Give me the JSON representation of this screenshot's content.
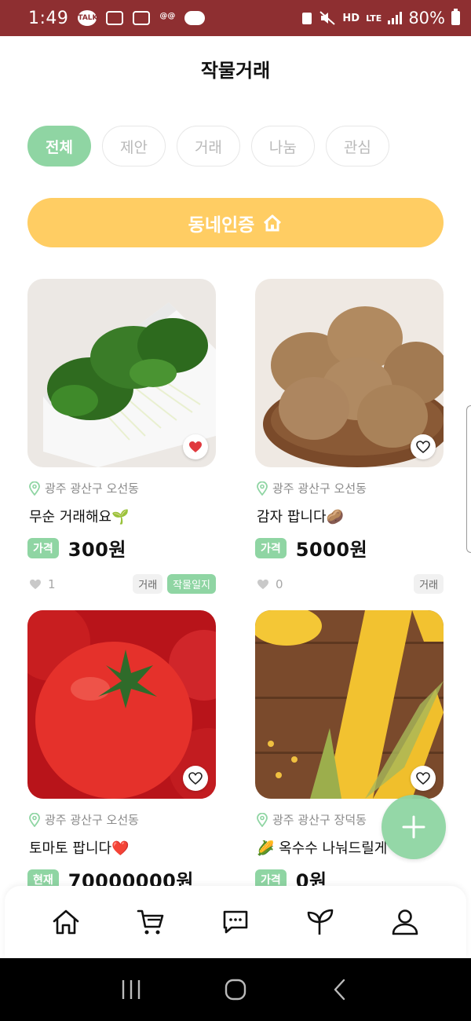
{
  "status_bar": {
    "time": "1:49",
    "icons": [
      "talk-icon",
      "screenshot-icon",
      "screen-record-icon",
      "app-icon",
      "cloud-icon"
    ],
    "network": "LTE",
    "hd_label": "HD",
    "battery": "80%"
  },
  "header": {
    "title": "작물거래"
  },
  "tabs": [
    {
      "label": "전체",
      "active": true
    },
    {
      "label": "제안",
      "active": false
    },
    {
      "label": "거래",
      "active": false
    },
    {
      "label": "나눔",
      "active": false
    },
    {
      "label": "관심",
      "active": false
    }
  ],
  "verify_button": {
    "label": "동네인증",
    "icon": "home-icon"
  },
  "accent_colors": {
    "green": "#8fd5a3",
    "yellow": "#ffcd63",
    "status_bar": "#8e2f31"
  },
  "posts": [
    {
      "image": "sprouts",
      "location": "광주 광산구 오선동",
      "title": "무순 거래해요🌱",
      "price_label": "가격",
      "price": "300원",
      "likes": "1",
      "liked": true,
      "tags": [
        "거래",
        "작물일지"
      ]
    },
    {
      "image": "potatoes",
      "location": "광주 광산구 오선동",
      "title": "감자 팝니다🥔",
      "price_label": "가격",
      "price": "5000원",
      "likes": "0",
      "liked": false,
      "tags": [
        "거래"
      ]
    },
    {
      "image": "tomato",
      "location": "광주 광산구 오선동",
      "title": "토마토 팝니다❤️",
      "price_label": "현재",
      "price": "70000000원",
      "liked": false
    },
    {
      "image": "corn",
      "location": "광주 광산구 장덕동",
      "title": "🌽 옥수수 나눠드릴게",
      "price_label": "가격",
      "price": "0원",
      "liked": false
    }
  ],
  "fab": {
    "icon": "plus-icon"
  },
  "bottom_nav": [
    {
      "icon": "home-icon"
    },
    {
      "icon": "cart-icon"
    },
    {
      "icon": "chat-icon"
    },
    {
      "icon": "sprout-icon"
    },
    {
      "icon": "profile-icon"
    }
  ]
}
